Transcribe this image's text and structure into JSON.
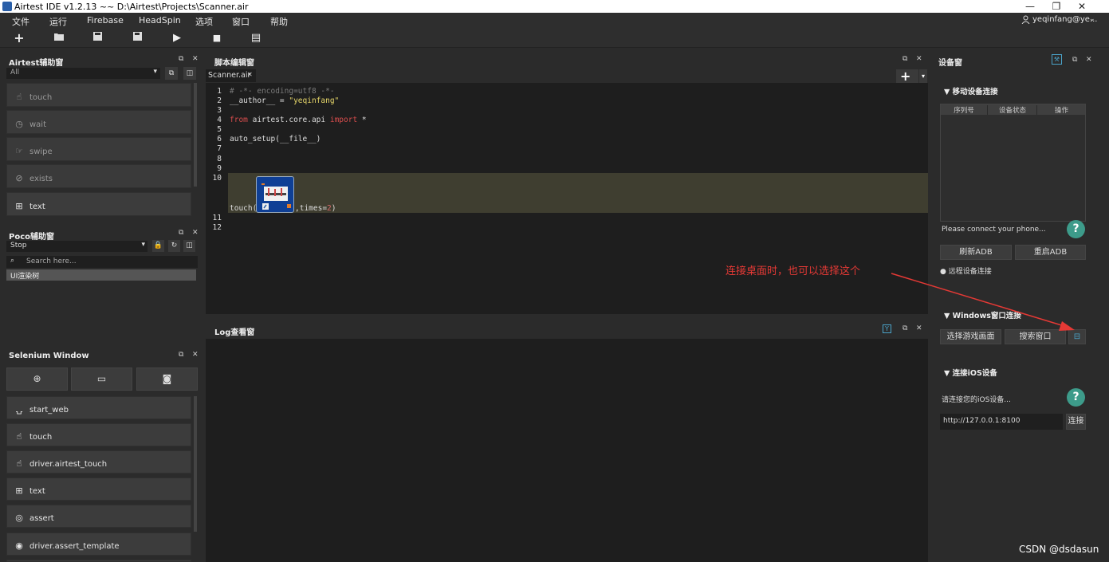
{
  "titlebar": {
    "title": "Airtest IDE v1.2.13 ~~ D:\\Airtest\\Projects\\Scanner.air",
    "minimize": "—",
    "restore": "❐",
    "close": "✕"
  },
  "menu": {
    "items": [
      "文件",
      "运行",
      "Firebase",
      "HeadSpin",
      "选项",
      "窗口",
      "帮助"
    ],
    "user": "yeqinfang@ye..."
  },
  "toolbar": {
    "new": "+",
    "open": "📂",
    "save": "💾",
    "save_all": "💾",
    "run": "▶",
    "stop": "■",
    "report": "▤"
  },
  "airtest_panel": {
    "title": "Airtest辅助窗",
    "filter_value": "All",
    "items": [
      "touch",
      "wait",
      "swipe",
      "exists",
      "text"
    ]
  },
  "poco_panel": {
    "title": "Poco辅助窗",
    "mode_value": "Stop",
    "search_placeholder": "Search here...",
    "tree_root": "UI渲染树"
  },
  "selenium_panel": {
    "title": "Selenium Window",
    "items": [
      "start_web",
      "touch",
      "driver.airtest_touch",
      "text",
      "assert",
      "driver.assert_template"
    ]
  },
  "editor": {
    "title": "脚本编辑窗",
    "tab": "Scanner.air",
    "tab_close": "✕",
    "add": "+",
    "line_numbers": [
      "1",
      "2",
      "3",
      "4",
      "5",
      "6",
      "7",
      "8",
      "9",
      "10",
      "11",
      "12"
    ],
    "line1": "# -*- encoding=utf8 -*-",
    "line2a": "__author__ = ",
    "line2b": "\"yeqinfang\"",
    "line4a": "from",
    "line4b": " airtest.core.api ",
    "line4c": "import",
    "line4d": " *",
    "line6": "auto_setup(__file__)",
    "line10a": "touch(",
    "line10b": ",times=",
    "line10c": "2",
    "line10d": ")"
  },
  "log_panel": {
    "title": "Log查看窗"
  },
  "device_panel": {
    "title": "设备窗",
    "mobile_header": "移动设备连接",
    "table_headers": [
      "序列号",
      "设备状态",
      "操作"
    ],
    "connect_hint": "Please connect your phone...",
    "refresh_adb": "刷新ADB",
    "restart_adb": "重启ADB",
    "remote_connect": "远程设备连接",
    "windows_header": "Windows窗口连接",
    "select_game": "选择游戏画面",
    "search_window": "搜索窗口",
    "ios_header": "连接iOS设备",
    "ios_hint": "请连接您的iOS设备...",
    "ios_url": "http://127.0.0.1:8100",
    "connect": "连接"
  },
  "annotation": {
    "text": "连接桌面时，也可以选择这个",
    "color": "#e53935"
  },
  "watermark": "CSDN @dsdasun",
  "colors": {
    "keyword": "#d84d4d",
    "string": "#e8d86a",
    "number": "#d86a6a",
    "comment": "#7a7a7a",
    "help": "#3d9b8a"
  }
}
